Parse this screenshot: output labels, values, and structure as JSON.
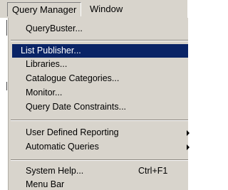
{
  "menubar": {
    "query_manager": "Query Manager",
    "window": "Window"
  },
  "menu": {
    "querybuster": "QueryBuster...",
    "list_publisher": "List Publisher...",
    "libraries": "Libraries...",
    "catalogue_categories": "Catalogue Categories...",
    "monitor": "Monitor...",
    "query_date_constraints": "Query Date Constraints...",
    "user_defined_reporting": "User Defined Reporting",
    "automatic_queries": "Automatic Queries",
    "system_help": "System Help...",
    "system_help_shortcut": "Ctrl+F1",
    "menu_bar": "Menu Bar"
  },
  "colors": {
    "menu_background": "#d8d4cc",
    "selection_highlight": "#0a2466"
  }
}
